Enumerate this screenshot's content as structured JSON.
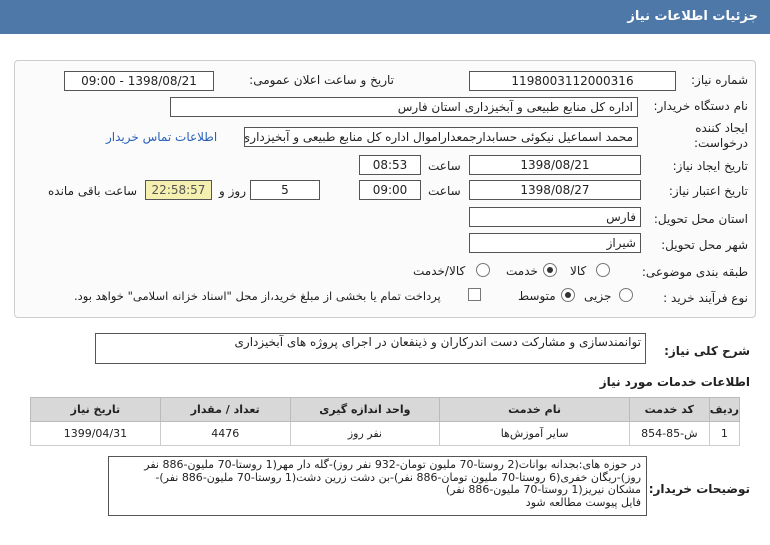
{
  "header": {
    "title": "جزئیات اطلاعات نیاز"
  },
  "fields": {
    "need_number_label": "شماره نیاز:",
    "need_number": "1198003112000316",
    "announce_label": "تاریخ و ساعت اعلان عمومی:",
    "announce_value": "1398/08/21 - 09:00",
    "buyer_label": "نام دستگاه خریدار:",
    "buyer_value": "اداره کل منابع طبیعی و آبخیزداری استان فارس",
    "creator_label_1": "ایجاد کننده",
    "creator_label_2": "درخواست:",
    "creator_value": "محمد اسماعیل نیکوئی  حسابدارجمعداراموال اداره کل منابع طبیعی و آبخیزداری",
    "contact_link": "اطلاعات تماس خریدار",
    "created_date_label": "تاریخ ایجاد نیاز:",
    "created_date": "1398/08/21",
    "created_time_label": "ساعت",
    "created_time": "08:53",
    "valid_date_label": "تاریخ اعتبار نیاز:",
    "valid_date": "1398/08/27",
    "valid_time_label": "ساعت",
    "valid_time": "09:00",
    "days_value": "5",
    "days_label": "روز و",
    "remaining_time": "22:58:57",
    "remaining_label": "ساعت باقی مانده",
    "province_label": "استان محل تحویل:",
    "province_value": "فارس",
    "city_label": "شهر محل تحویل:",
    "city_value": "شیراز",
    "category_label": "طبقه بندی موضوعی:",
    "category_options": [
      "کالا",
      "خدمت",
      "کالا/خدمت"
    ],
    "category_selected": "خدمت",
    "process_label": "نوع فرآیند خرید :",
    "process_options": [
      "جزیی",
      "متوسط"
    ],
    "process_selected": "متوسط",
    "payment_note": "پرداخت تمام یا بخشی از مبلغ خرید،از محل \"اسناد خزانه اسلامی\" خواهد بود."
  },
  "summary": {
    "label": "شرح کلی نیاز:",
    "value": "توانمندسازی و مشارکت دست اندرکاران و ذینفعان در اجرای پروژه های آبخیزداری"
  },
  "services": {
    "title": "اطلاعات خدمات مورد نیاز",
    "columns": [
      "ردیف",
      "کد خدمت",
      "نام خدمت",
      "واحد اندازه گیری",
      "تعداد / مقدار",
      "تاریخ نیاز"
    ],
    "rows": [
      [
        "1",
        "ش-85-854",
        "سایر آموزش‌ها",
        "نفر روز",
        "4476",
        "1399/04/31"
      ]
    ]
  },
  "buyer_notes": {
    "label": "توضیحات خریدار:",
    "lines": [
      "در حوزه های:بجدانه بوانات(2 روستا-70 ملیون تومان-932 نفر روز)-گله دار مهر(1 روستا-70 ملیون-886 نفر",
      "روز)-ریگان خفری(6 روستا-70 ملیون تومان-886 نفر)-بن دشت زرین دشت(1 روستا-70 ملیون-886 نفر)-",
      "مشکان نیریز(1 روستا-70 ملیون-886 نفر)",
      "فایل پیوست مطالعه شود"
    ]
  }
}
